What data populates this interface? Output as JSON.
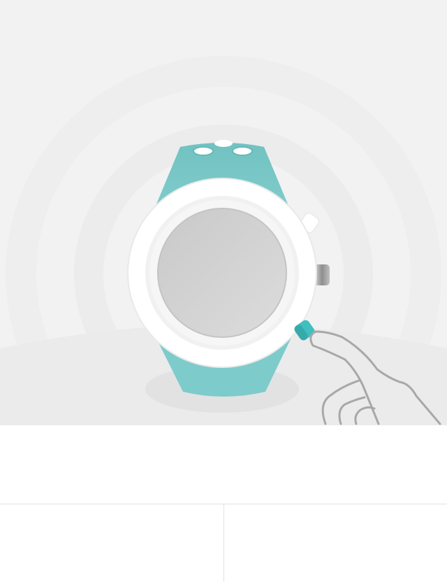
{
  "illustration": {
    "device": "smartwatch",
    "action": "press-lower-button",
    "colors": {
      "background": "#f2f2f2",
      "ripple": "#ececec",
      "strap": "#7ecbcb",
      "bezel": "#ffffff",
      "face": "#d2d2d2",
      "highlight_button": "#3fbfbf",
      "hand_outline": "#a8a8a8"
    },
    "icons": [
      "watch-icon",
      "hand-icon"
    ]
  },
  "instruction": {
    "text": ""
  },
  "buttons": {
    "left_label": "",
    "right_label": ""
  }
}
